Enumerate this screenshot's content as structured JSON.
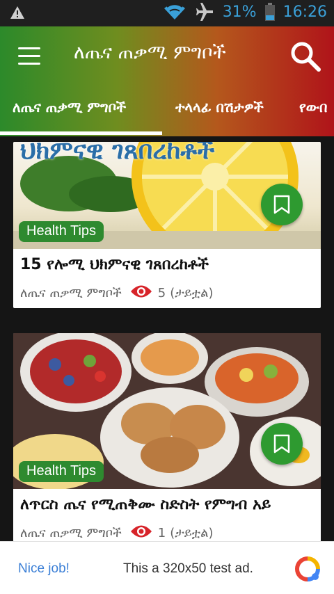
{
  "status_bar": {
    "battery": "31%",
    "time": "16:26"
  },
  "app_bar": {
    "title": "ለጤና ጠቃሚ ምግቦች"
  },
  "tabs": [
    {
      "label": "ለጤና ጠቃሚ ምግቦች",
      "selected": true
    },
    {
      "label": "ተላላፊ በሽታዎች",
      "selected": false
    },
    {
      "label": "የውበ",
      "selected": false
    }
  ],
  "articles": [
    {
      "category": "Health Tips",
      "title": "15 የሎሚ ህክምናዊ ገጸበረከቶች",
      "source": "ለጤና ጠቃሚ ምግቦች",
      "views": "5",
      "views_label": "(ታይቷል)",
      "image_caption": "ህክምናዊ ገጸበረከቶች"
    },
    {
      "category": "Health Tips",
      "title": "ለጥርስ ጤና የሚጠቅሙ ስድስት የምግብ አይ",
      "source": "ለጤና ጠቃሚ ምግቦች",
      "views": "1",
      "views_label": "(ታይቷል)"
    }
  ],
  "ad": {
    "nice_label": "Nice job!",
    "text": "This a 320x50 test ad."
  },
  "colors": {
    "appbar_start": "#2c8a2a",
    "appbar_end": "#b0141a",
    "accent_green": "#2e8a2f",
    "eye_red": "#d7242a"
  }
}
